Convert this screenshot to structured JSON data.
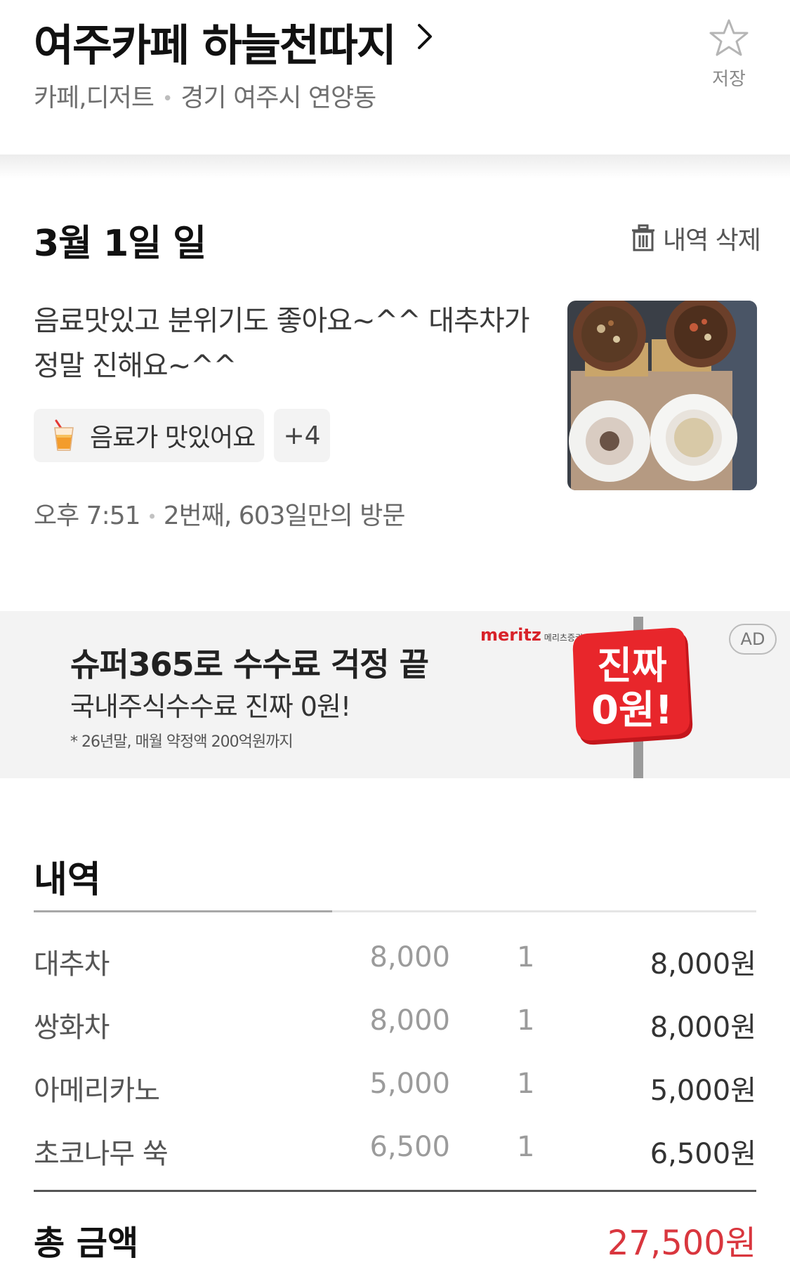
{
  "header": {
    "place_name": "여주카페 하늘천따지",
    "category": "카페,디저트",
    "location": "경기 여주시 연양동",
    "save_label": "저장"
  },
  "visit": {
    "date": "3월 1일 일",
    "delete_label": "내역 삭제",
    "review": "음료맛있고 분위기도 좋아요~^^ 대추차가정말 진해요~^^",
    "tag_label": "음료가 맛있어요",
    "tag_more": "+4",
    "time": "오후 7:51",
    "visit_count": "2번째, 603일만의 방문"
  },
  "ad": {
    "headline": "슈퍼365로 수수료 걱정 끝",
    "sub": "국내주식수수료 진짜 0원!",
    "note": "* 26년말, 매월 약정액 200억원까지",
    "brand": "meritz",
    "brand_sub": "메리츠증권",
    "sign_line1": "진짜",
    "sign_line2": "0원!",
    "badge": "AD"
  },
  "details": {
    "heading": "내역",
    "items": [
      {
        "name": "대추차",
        "price": "8,000",
        "qty": "1",
        "total": "8,000원"
      },
      {
        "name": "쌍화차",
        "price": "8,000",
        "qty": "1",
        "total": "8,000원"
      },
      {
        "name": "아메리카노",
        "price": "5,000",
        "qty": "1",
        "total": "5,000원"
      },
      {
        "name": "초코나무 쑥",
        "price": "6,500",
        "qty": "1",
        "total": "6,500원"
      }
    ],
    "total_label": "총 금액",
    "total_value": "27,500원"
  },
  "colors": {
    "accent_red": "#d9363e",
    "ad_background": "#f3f3f3",
    "brand_red": "#d8232a"
  },
  "icons": [
    "chevron-right-icon",
    "star-icon",
    "trash-icon",
    "drink-icon"
  ]
}
